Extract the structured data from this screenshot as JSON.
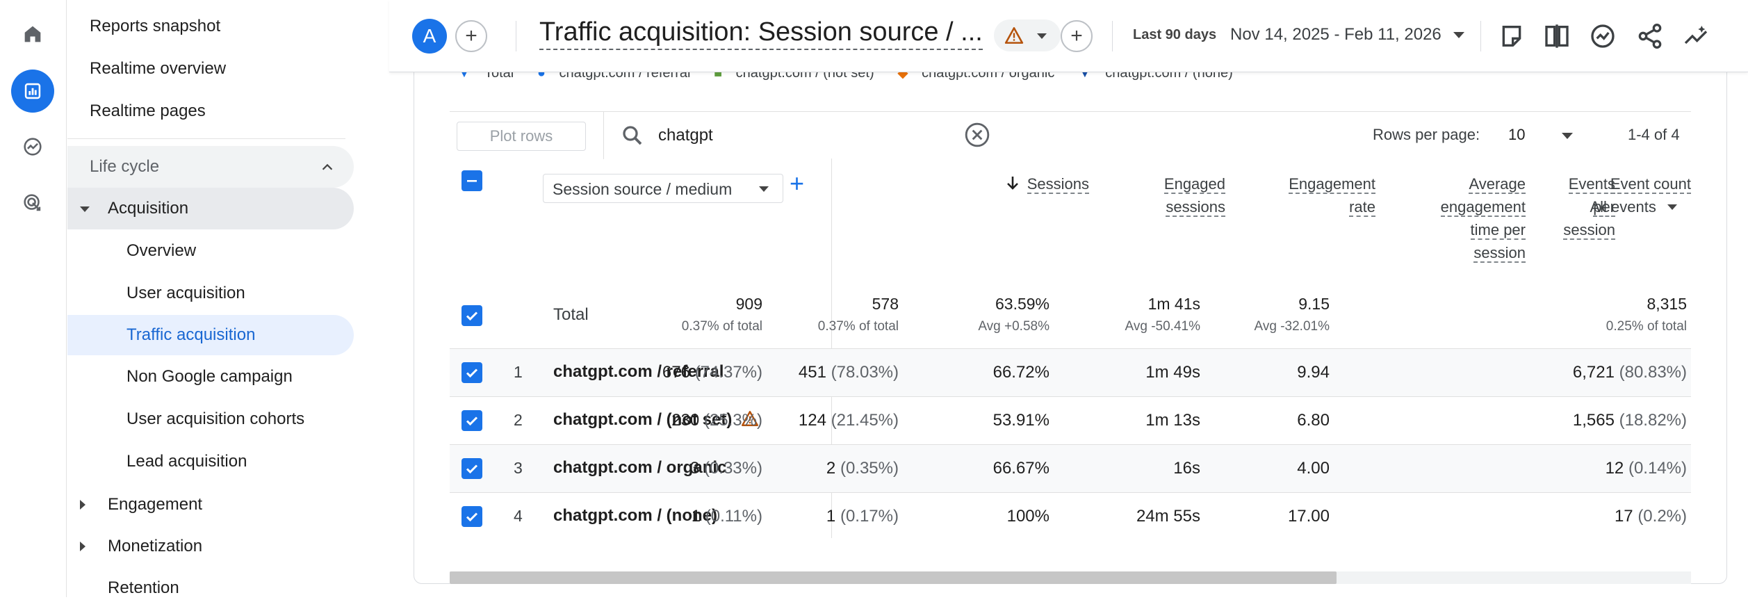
{
  "rail": {
    "items": [
      {
        "icon": "home-icon"
      },
      {
        "icon": "reports-icon",
        "active": true
      },
      {
        "icon": "explore-icon"
      },
      {
        "icon": "advertising-icon"
      }
    ]
  },
  "sidenav": {
    "top_items": [
      "Reports snapshot",
      "Realtime overview",
      "Realtime pages"
    ],
    "lifecycle": "Life cycle",
    "acquisition": "Acquisition",
    "acquisition_items": [
      "Overview",
      "User acquisition",
      "Traffic acquisition",
      "Non Google campaign",
      "User acquisition cohorts",
      "Lead acquisition"
    ],
    "selected_item": "Traffic acquisition",
    "engagement": "Engagement",
    "monetization": "Monetization",
    "retention": "Retention"
  },
  "header": {
    "avatar_letter": "A",
    "title": "Traffic acquisition: Session source / ...",
    "date_label": "Last 90 days",
    "date_range": "Nov 14, 2025 - Feb 11, 2026"
  },
  "legend": {
    "items": [
      {
        "label": "Total",
        "color": "#1a73e8"
      },
      {
        "label": "chatgpt.com / referral",
        "color": "#1a73e8"
      },
      {
        "label": "chatgpt.com / (not set)",
        "color": "#5f9e3f"
      },
      {
        "label": "chatgpt.com / organic",
        "color": "#e8710a"
      },
      {
        "label": "chatgpt.com / (none)",
        "color": "#174ea6"
      }
    ]
  },
  "toolbar": {
    "plot_rows": "Plot rows",
    "search_value": "chatgpt",
    "rows_per_page_label": "Rows per page:",
    "rows_per_page_value": "10",
    "pager": "1-4 of 4"
  },
  "table": {
    "dimension_label": "Session source / medium",
    "headers": {
      "sessions": "Sessions",
      "engaged_1": "Engaged",
      "engaged_2": "sessions",
      "rate_1": "Engagement",
      "rate_2": "rate",
      "avg_1": "Average",
      "avg_2": "engagement",
      "avg_3": "time per",
      "avg_4": "session",
      "eps_1": "Events",
      "eps_2": "per",
      "eps_3": "session",
      "events": "Event count",
      "events_sub": "All events"
    },
    "total": {
      "label": "Total",
      "sessions": "909",
      "sessions_sub": "0.37% of total",
      "engaged": "578",
      "engaged_sub": "0.37% of total",
      "rate": "63.59%",
      "rate_sub": "Avg +0.58%",
      "avg_time": "1m 41s",
      "avg_time_sub": "Avg -50.41%",
      "eps": "9.15",
      "eps_sub": "Avg -32.01%",
      "events": "8,315",
      "events_sub": "0.25% of total"
    },
    "rows": [
      {
        "idx": "1",
        "dim": "chatgpt.com / referral",
        "sessions": "676",
        "sessions_pct": "(74.37%)",
        "engaged": "451",
        "engaged_pct": "(78.03%)",
        "rate": "66.72%",
        "avg_time": "1m 49s",
        "eps": "9.94",
        "events": "6,721",
        "events_pct": "(80.83%)"
      },
      {
        "idx": "2",
        "dim": "chatgpt.com / (not set)",
        "sessions": "230",
        "sessions_pct": "(25.3%)",
        "engaged": "124",
        "engaged_pct": "(21.45%)",
        "rate": "53.91%",
        "avg_time": "1m 13s",
        "eps": "6.80",
        "events": "1,565",
        "events_pct": "(18.82%)"
      },
      {
        "idx": "3",
        "dim": "chatgpt.com / organic",
        "sessions": "3",
        "sessions_pct": "(0.33%)",
        "engaged": "2",
        "engaged_pct": "(0.35%)",
        "rate": "66.67%",
        "avg_time": "16s",
        "eps": "4.00",
        "events": "12",
        "events_pct": "(0.14%)"
      },
      {
        "idx": "4",
        "dim": "chatgpt.com / (none)",
        "sessions": "1",
        "sessions_pct": "(0.11%)",
        "engaged": "1",
        "engaged_pct": "(0.17%)",
        "rate": "100%",
        "avg_time": "24m 55s",
        "eps": "17.00",
        "events": "17",
        "events_pct": "(0.2%)"
      }
    ]
  }
}
